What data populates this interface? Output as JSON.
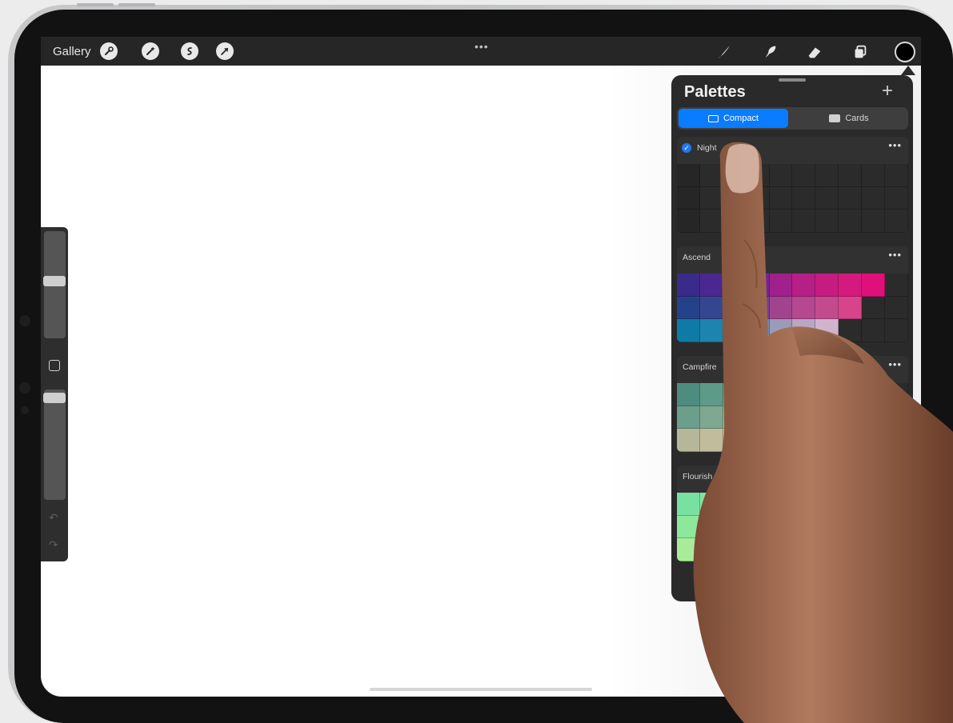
{
  "toolbar": {
    "gallery_label": "Gallery",
    "left_tools": [
      "wrench-icon",
      "magic-wand-icon",
      "selection-icon",
      "transform-arrow-icon"
    ],
    "right_tools": [
      "brush-icon",
      "smudge-icon",
      "eraser-icon",
      "layers-icon"
    ],
    "more_label": "•••",
    "current_color": "#000000"
  },
  "palettes_panel": {
    "title": "Palettes",
    "add_label": "+",
    "view_modes": [
      {
        "label": "Compact",
        "active": true
      },
      {
        "label": "Cards",
        "active": false
      }
    ],
    "more_label": "•••",
    "palettes": [
      {
        "name": "Night",
        "default": true,
        "swatches": [
          [
            "#262626",
            "#2b2b2b",
            "#2b2b2b",
            "#2b2b2b",
            "#2b2b2b",
            "#2b2b2b",
            "#2b2b2b",
            "#2b2b2b",
            "#2b2b2b",
            "#2b2b2b"
          ],
          [
            "#262626",
            "#2b2b2b",
            "#2b2b2b",
            "#2b2b2b",
            "#2b2b2b",
            "#2b2b2b",
            "#2b2b2b",
            "#2b2b2b",
            "#2b2b2b",
            "#2b2b2b"
          ],
          [
            "#262626",
            "#2b2b2b",
            "#2b2b2b",
            "#2b2b2b",
            "#2b2b2b",
            "#2b2b2b",
            "#2b2b2b",
            "#2b2b2b",
            "#2b2b2b",
            "#2b2b2b"
          ]
        ]
      },
      {
        "name": "Ascend",
        "default": false,
        "swatches": [
          [
            "#3a2a8a",
            "#4a2890",
            "#5a2894",
            "#7a2296",
            "#a0208c",
            "#b61f86",
            "#c61c82",
            "#d41a7e",
            "#e0107a",
            "#2b2b2b"
          ],
          [
            "#23428a",
            "#34468f",
            "#4a4a94",
            "#7a3e8f",
            "#a0448e",
            "#b54890",
            "#c44a8e",
            "#d8448c",
            "#2b2b2b",
            "#2b2b2b"
          ],
          [
            "#0f7aa6",
            "#1c84ae",
            "#2e8eb4",
            "#6e8cb0",
            "#9c9ab8",
            "#b8a6c4",
            "#d0b4cc",
            "#2b2b2b",
            "#2b2b2b",
            "#2b2b2b"
          ]
        ]
      },
      {
        "name": "Campfire",
        "default": false,
        "swatches": [
          [
            "#4f8c80",
            "#5e9a88",
            "#9cc09a",
            "#b8c89c",
            "#c8c894",
            "#d8c48a",
            "#e0b880",
            "#e6ac76",
            "#2b2b2b",
            "#2b2b2b"
          ],
          [
            "#6c9e8c",
            "#7ea890",
            "#b0c49e",
            "#c2caa0",
            "#d0cc9a",
            "#dcc690",
            "#e2bc86",
            "#2b2b2b",
            "#2b2b2b",
            "#2b2b2b"
          ],
          [
            "#b6b69a",
            "#c0bc9c",
            "#d8d49e",
            "#dcd29c",
            "#e0cc96",
            "#e4c690",
            "#2b2b2b",
            "#2b2b2b",
            "#2b2b2b",
            "#2b2b2b"
          ]
        ]
      },
      {
        "name": "Flourish",
        "default": false,
        "swatches": [
          [
            "#78e0a0",
            "#82e4a0",
            "#8ce69e",
            "#98e69c",
            "#a4e49a",
            "#2b2b2b",
            "#2b2b2b",
            "#2b2b2b",
            "#2b2b2b",
            "#2b2b2b"
          ],
          [
            "#8ce89a",
            "#96ea98",
            "#a0ea96",
            "#aee894",
            "#2b2b2b",
            "#2b2b2b",
            "#2b2b2b",
            "#2b2b2b",
            "#2b2b2b",
            "#2b2b2b"
          ],
          [
            "#a8ec9a",
            "#b2ec98",
            "#bcec96",
            "#2b2b2b",
            "#2b2b2b",
            "#2b2b2b",
            "#2b2b2b",
            "#2b2b2b",
            "#2b2b2b",
            "#2b2b2b"
          ]
        ]
      }
    ]
  },
  "sidebar": {
    "brush_size_level": 0.45,
    "opacity_level": 0.95,
    "modify_icon": "square-icon",
    "undo_icon": "undo-arrow-icon",
    "redo_icon": "redo-arrow-icon"
  }
}
